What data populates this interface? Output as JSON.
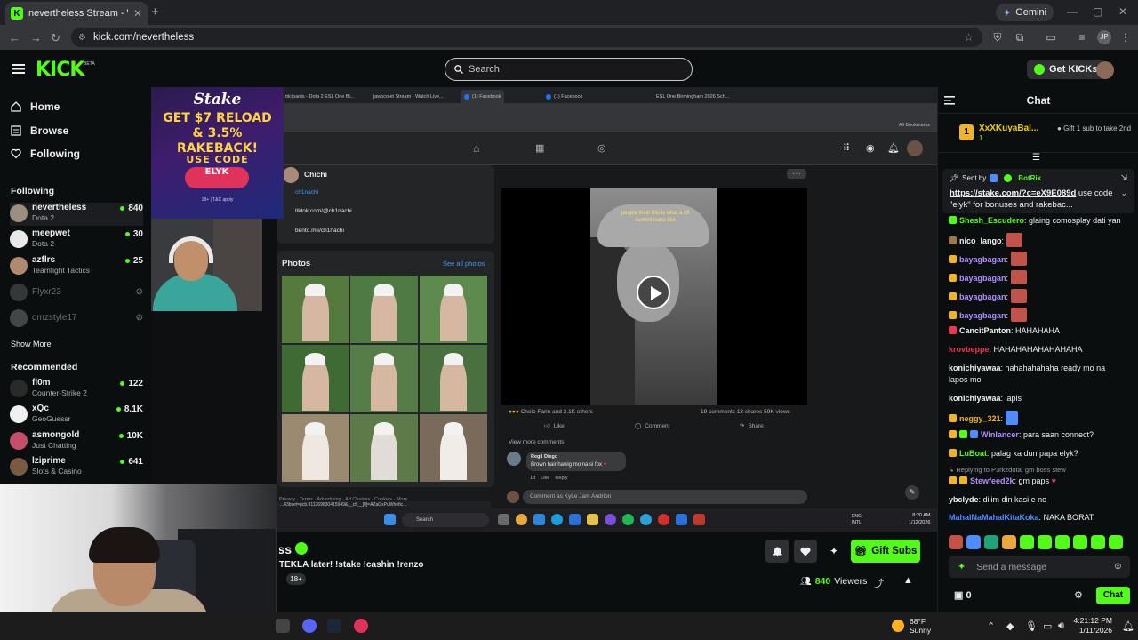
{
  "browser": {
    "tab_title": "nevertheless Stream - Watch Li...",
    "url": "kick.com/nevertheless",
    "gemini_label": "Gemini",
    "profile_initials": "JP"
  },
  "header": {
    "logo": "KICK",
    "logo_badge": "BETA",
    "search_placeholder": "Search",
    "get_kicks_label": "Get KICKs"
  },
  "sidebar": {
    "nav": [
      {
        "label": "Home",
        "icon": "home-icon"
      },
      {
        "label": "Browse",
        "icon": "browse-icon"
      },
      {
        "label": "Following",
        "icon": "heart-icon"
      }
    ],
    "following_title": "Following",
    "following": [
      {
        "name": "nevertheless",
        "category": "Dota 2",
        "viewers": "840",
        "live": true
      },
      {
        "name": "meepwet",
        "category": "Dota 2",
        "viewers": "30",
        "live": true
      },
      {
        "name": "azflrs",
        "category": "Teamfight Tactics",
        "viewers": "25",
        "live": true
      },
      {
        "name": "Flyxr23",
        "category": "",
        "viewers": "",
        "live": false
      },
      {
        "name": "omzstyle17",
        "category": "",
        "viewers": "",
        "live": false
      }
    ],
    "show_more": "Show More",
    "recommended_title": "Recommended",
    "recommended": [
      {
        "name": "fl0m",
        "category": "Counter-Strike 2",
        "viewers": "122"
      },
      {
        "name": "xQc",
        "category": "GeoGuessr",
        "viewers": "8.1K"
      },
      {
        "name": "asmongold",
        "category": "Just Chatting",
        "viewers": "10K"
      },
      {
        "name": "lziprime",
        "category": "Slots & Casino",
        "viewers": "641"
      }
    ]
  },
  "stake_ad": {
    "brand": "Stake",
    "headline_1": "GET $7 RELOAD",
    "headline_2": "& 3.5% RAKEBACK!",
    "use_code": "USE CODE",
    "code": "ELYK",
    "tc": "18+ | T&C apply"
  },
  "share": {
    "tabs": [
      "...rticipants - Dota 2 ESL One Bi...",
      "jawocolet Stream - Watch Live...",
      "(1) Facebook",
      "(1) Facebook",
      "ESL One Birmingham 2026 Sch..."
    ],
    "bookmarks_label": "All Bookmarks",
    "profile_name": "Chichi",
    "handle": "ch1nachi",
    "links": [
      "tiktok.com/@ch1nachi",
      "bento.me/ch1nachi"
    ],
    "photos_title": "Photos",
    "see_all": "See all photos",
    "video_caption": "people think this is what a cfl summit looks like",
    "reactions": "Cholo Farin and 2.1K others",
    "stats": "19 comments   13 shares   59K views",
    "like": "Like",
    "comment": "Comment",
    "share": "Share",
    "view_more_comments": "View more comments",
    "commenter": "Regil Diego",
    "comment_text": "Brown hair hawig mo na si fox",
    "comment_meta": "1d    Like    Reply",
    "comment_as": "Comment as KyLe Jam Andrion",
    "footer_links": "Privacy · Terms · Advertising · Ad Choices · Cookies · More",
    "status_url": "...43bset=pcb.911269630415949&__cft__[0]=AZaGxPuWhefic...",
    "taskbar_search": "Search",
    "tray_lang": "ENG INTL",
    "time": "8:20 AM",
    "date": "1/12/2026"
  },
  "stream_info": {
    "channel_name": "nevertheless",
    "title": "TEKLA later! !stake !cashin !renzo",
    "tag": "18+",
    "gift_subs_label": "Gift Subs",
    "viewers_count": "840",
    "viewers_label": "Viewers"
  },
  "chat": {
    "title": "Chat",
    "leader_rank": "1",
    "leader_name": "XxXKuyaBal...",
    "leader_amount": "1",
    "leader_gift": "Gift 1 sub to take 2nd",
    "pinned_by": "Sent by",
    "pinned_user": "BotRix",
    "pinned_link": "https://stake.com/?c=eX9E089d",
    "pinned_text": " use code \"elyk\" for bonuses and rakebac...",
    "messages": [
      {
        "user": "Shesh_Escudero",
        "color": "#53fc18",
        "text": "glaing comosplay dati yan"
      },
      {
        "user": "nico_lango",
        "color": "#efeff1",
        "text": ""
      },
      {
        "user": "bayagbagan",
        "color": "#b28cff",
        "text": ""
      },
      {
        "user": "bayagbagan",
        "color": "#b28cff",
        "text": ""
      },
      {
        "user": "bayagbagan",
        "color": "#b28cff",
        "text": ""
      },
      {
        "user": "bayagbagan",
        "color": "#b28cff",
        "text": ""
      },
      {
        "user": "CancitPanton",
        "color": "#efeff1",
        "text": "HAHAHAHA"
      },
      {
        "user": "krovbeppe",
        "color": "#e8394f",
        "text": "HAHAHAHAHAHAHAHA"
      },
      {
        "user": "konichiyawaa",
        "color": "#ffffff",
        "text": "hahahahahaha ready mo na lapos mo"
      },
      {
        "user": "konichiyawaa",
        "color": "#ffffff",
        "text": "lapis"
      },
      {
        "user": "neggy_321",
        "color": "#f0b429",
        "text": ""
      },
      {
        "user": "Winlancer",
        "color": "#b28cff",
        "text": "para saan connect?"
      },
      {
        "user": "LuBoat",
        "color": "#53fc18",
        "text": "palag ka dun papa elyk?"
      },
      {
        "user": "Stewfeed2k",
        "color": "#b28cff",
        "text": "gm paps"
      },
      {
        "user": "ybclyde",
        "color": "#efeff1",
        "text": "dilim din kasi e no"
      },
      {
        "user": "MahalNaMahalKitaKoka",
        "color": "#4f8dff",
        "text": "NAKA BORAT"
      }
    ],
    "reply_note": "Replying to P3rkzdota: gm boss stew",
    "input_placeholder": "Send a message",
    "points": "0",
    "send_label": "Chat"
  },
  "taskbar": {
    "temp": "68°F",
    "condition": "Sunny",
    "time": "4:21:12 PM",
    "date": "1/11/2026"
  },
  "colors": {
    "kick_green": "#53fc18",
    "background": "#0b0e0f"
  }
}
